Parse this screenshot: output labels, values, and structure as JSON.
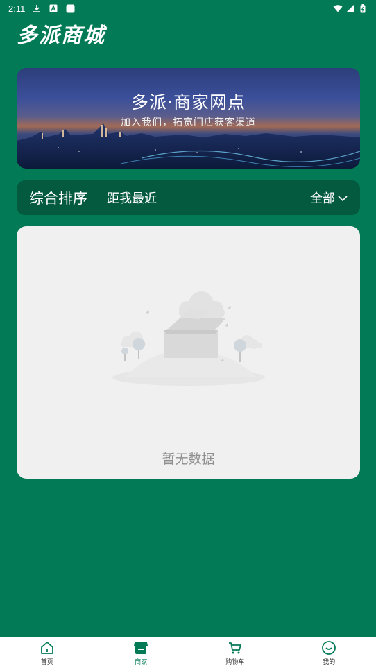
{
  "status_bar": {
    "time": "2:11",
    "icons": [
      "download-icon",
      "a-icon",
      "square-icon",
      "wifi-icon",
      "signal-icon",
      "battery-icon"
    ]
  },
  "app": {
    "title": "多派商城"
  },
  "banner": {
    "title": "多派·商家网点",
    "subtitle": "加入我们，拓宽门店获客渠道"
  },
  "filters": {
    "items": [
      {
        "label": "综合排序",
        "active": true
      },
      {
        "label": "距我最近",
        "active": false
      }
    ],
    "scope": "全部"
  },
  "empty_state": {
    "message": "暂无数据"
  },
  "tabbar": {
    "items": [
      {
        "label": "首页",
        "icon": "home-icon",
        "active": false
      },
      {
        "label": "商家",
        "icon": "store-icon",
        "active": true
      },
      {
        "label": "购物车",
        "icon": "cart-icon",
        "active": false
      },
      {
        "label": "我的",
        "icon": "smile-icon",
        "active": false
      }
    ]
  },
  "colors": {
    "primary": "#027a55",
    "filter_bg": "#045a3f",
    "card_bg": "#f0f0f0",
    "empty_text": "#8f8f8f"
  }
}
